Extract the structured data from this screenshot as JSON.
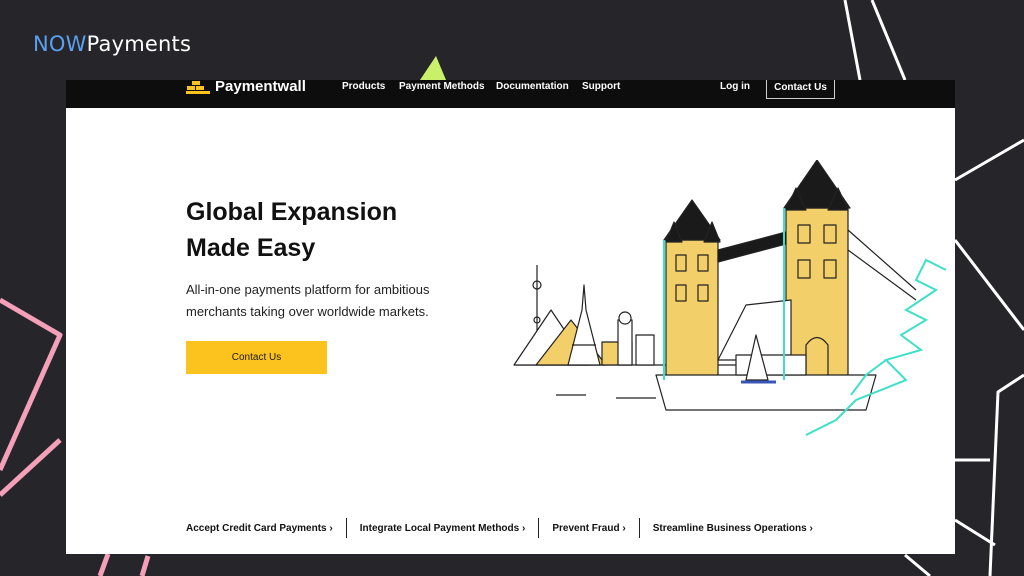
{
  "brand": {
    "now": "NOW",
    "payments": "Payments"
  },
  "nav": {
    "logo": "Paymentwall",
    "links": [
      "Products",
      "Payment Methods",
      "Documentation",
      "Support"
    ],
    "login": "Log in",
    "contact": "Contact Us"
  },
  "hero": {
    "title_line1": "Global Expansion",
    "title_line2": "Made Easy",
    "subtitle": "All-in-one payments platform for ambitious merchants taking over worldwide markets.",
    "cta": "Contact Us"
  },
  "footer_links": [
    "Accept Credit Card Payments",
    "Integrate Local Payment Methods",
    "Prevent Fraud",
    "Streamline Business Operations"
  ],
  "footer_chevron": "›",
  "colors": {
    "background": "#25252a",
    "accent_yellow": "#fcc31e",
    "brand_blue": "#5aa0f0",
    "deco_pink": "#f48fb1",
    "deco_lime": "#c8f06a",
    "illus_teal": "#3ee0c8"
  }
}
